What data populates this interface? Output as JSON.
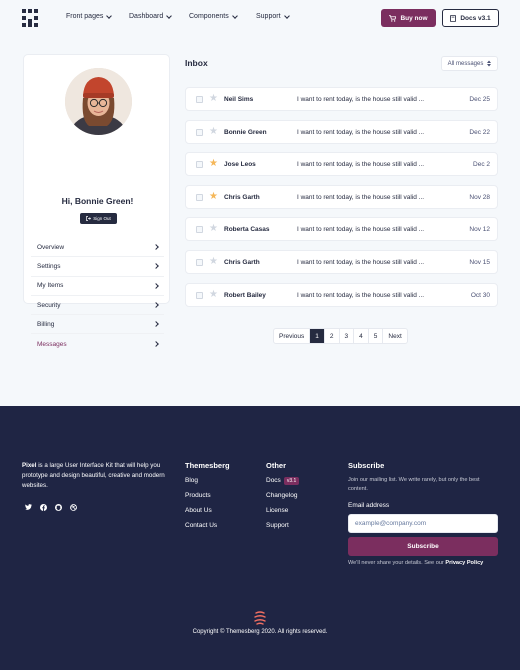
{
  "nav": {
    "links": [
      "Front pages",
      "Dashboard",
      "Components",
      "Support"
    ],
    "buy_label": "Buy now",
    "docs_label": "Docs v3.1"
  },
  "profile": {
    "greeting": "Hi, Bonnie Green!",
    "signout_label": "Sign Out",
    "menu": [
      "Overview",
      "Settings",
      "My Items",
      "Security",
      "Billing",
      "Messages"
    ],
    "active_item": "Messages"
  },
  "inbox": {
    "title": "Inbox",
    "filter_label": "All messages",
    "messages": [
      {
        "name": "Neil Sims",
        "preview": "I want to rent today, is the house still valid ...",
        "date": "Dec 25",
        "starred": false
      },
      {
        "name": "Bonnie Green",
        "preview": "I want to rent today, is the house still valid ...",
        "date": "Dec 22",
        "starred": false
      },
      {
        "name": "Jose Leos",
        "preview": "I want to rent today, is the house still valid ...",
        "date": "Dec 2",
        "starred": true
      },
      {
        "name": "Chris Garth",
        "preview": "I want to rent today, is the house still valid ...",
        "date": "Nov 28",
        "starred": true
      },
      {
        "name": "Roberta Casas",
        "preview": "I want to rent today, is the house still valid ...",
        "date": "Nov 12",
        "starred": false
      },
      {
        "name": "Chris Garth",
        "preview": "I want to rent today, is the house still valid ...",
        "date": "Nov 15",
        "starred": false
      },
      {
        "name": "Robert Bailey",
        "preview": "I want to rent today, is the house still valid ...",
        "date": "Oct 30",
        "starred": false
      }
    ]
  },
  "pagination": {
    "prev": "Previous",
    "pages": [
      "1",
      "2",
      "3",
      "4",
      "5"
    ],
    "next": "Next",
    "current": "1"
  },
  "footer": {
    "brand": "Pixel",
    "about": "is a large User Interface Kit that will help you prototype and design beautiful, creative and modern websites.",
    "social_icons": [
      "twitter-icon",
      "facebook-icon",
      "github-icon",
      "dribbble-icon"
    ],
    "col1": {
      "title": "Themesberg",
      "links": [
        "Blog",
        "Products",
        "About Us",
        "Contact Us"
      ]
    },
    "col2": {
      "title": "Other",
      "links": [
        "Docs",
        "Changelog",
        "License",
        "Support"
      ],
      "docs_badge": "v3.1"
    },
    "subscribe": {
      "title": "Subscribe",
      "text": "Join our mailing list. We write rarely, but only the best content.",
      "email_label": "Email address",
      "email_placeholder": "example@company.com",
      "button": "Subscribe",
      "privacy_text": "We'll never share your details. See our",
      "privacy_link": "Privacy Policy"
    },
    "copyright": "Copyright © Themesberg 2020. All rights reserved."
  },
  "colors": {
    "primary": "#262b40",
    "accent": "#7b2e5f",
    "footer_bg": "#1f2544",
    "star": "#f5b759"
  }
}
